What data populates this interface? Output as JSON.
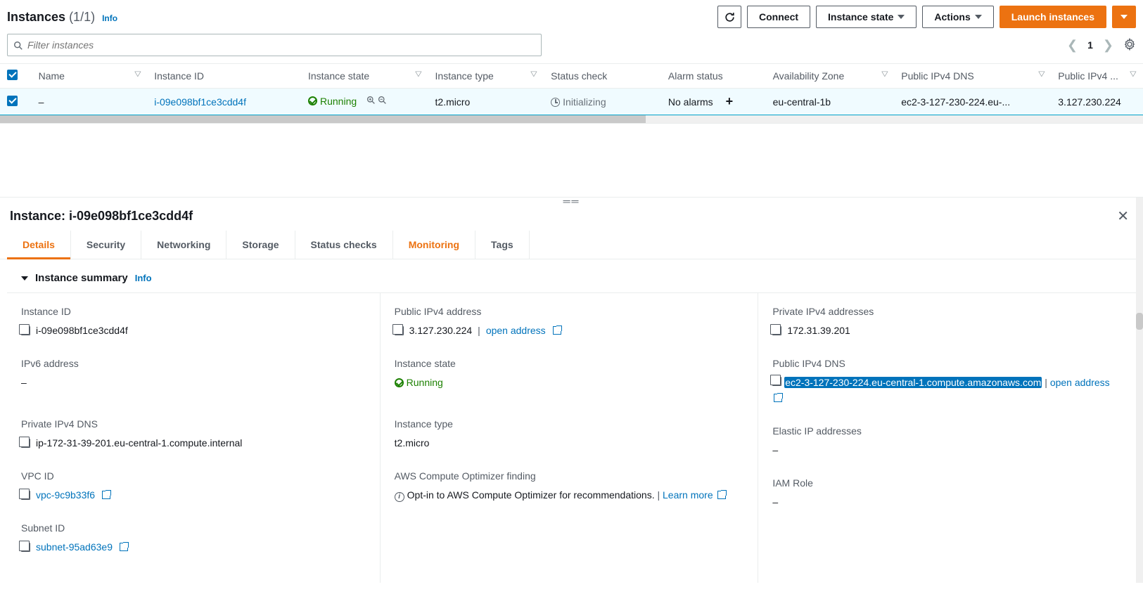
{
  "header": {
    "title": "Instances",
    "count": "(1/1)",
    "info": "Info",
    "connect": "Connect",
    "instance_state_btn": "Instance state",
    "actions_btn": "Actions",
    "launch_btn": "Launch instances"
  },
  "filter": {
    "placeholder": "Filter instances",
    "page": "1"
  },
  "columns": {
    "name": "Name",
    "instance_id": "Instance ID",
    "instance_state": "Instance state",
    "instance_type": "Instance type",
    "status_check": "Status check",
    "alarm_status": "Alarm status",
    "az": "Availability Zone",
    "public_dns": "Public IPv4 DNS",
    "public_ip": "Public IPv4 ..."
  },
  "row": {
    "name": "–",
    "instance_id": "i-09e098bf1ce3cdd4f",
    "state": "Running",
    "type": "t2.micro",
    "status": "Initializing",
    "alarms": "No alarms",
    "az": "eu-central-1b",
    "public_dns": "ec2-3-127-230-224.eu-...",
    "public_ip": "3.127.230.224"
  },
  "panel": {
    "title_prefix": "Instance: ",
    "title_id": "i-09e098bf1ce3cdd4f",
    "tabs": {
      "details": "Details",
      "security": "Security",
      "networking": "Networking",
      "storage": "Storage",
      "status": "Status checks",
      "monitoring": "Monitoring",
      "tags": "Tags"
    },
    "summary_title": "Instance summary",
    "info": "Info"
  },
  "details": {
    "instance_id_label": "Instance ID",
    "instance_id": "i-09e098bf1ce3cdd4f",
    "public_ipv4_label": "Public IPv4 address",
    "public_ipv4": "3.127.230.224",
    "open_address": "open address",
    "private_ipv4_label": "Private IPv4 addresses",
    "private_ipv4": "172.31.39.201",
    "ipv6_label": "IPv6 address",
    "ipv6": "–",
    "state_label": "Instance state",
    "state": "Running",
    "public_dns_label": "Public IPv4 DNS",
    "public_dns": "ec2-3-127-230-224.eu-central-1.compute.amazonaws.com",
    "private_dns_label": "Private IPv4 DNS",
    "private_dns": "ip-172-31-39-201.eu-central-1.compute.internal",
    "type_label": "Instance type",
    "type": "t2.micro",
    "elastic_ip_label": "Elastic IP addresses",
    "elastic_ip": "–",
    "vpc_label": "VPC ID",
    "vpc": "vpc-9c9b33f6",
    "optimizer_label": "AWS Compute Optimizer finding",
    "optimizer_text": "Opt-in to AWS Compute Optimizer for recommendations.",
    "learn_more": "Learn more",
    "iam_label": "IAM Role",
    "iam": "–",
    "subnet_label": "Subnet ID",
    "subnet": "subnet-95ad63e9"
  }
}
